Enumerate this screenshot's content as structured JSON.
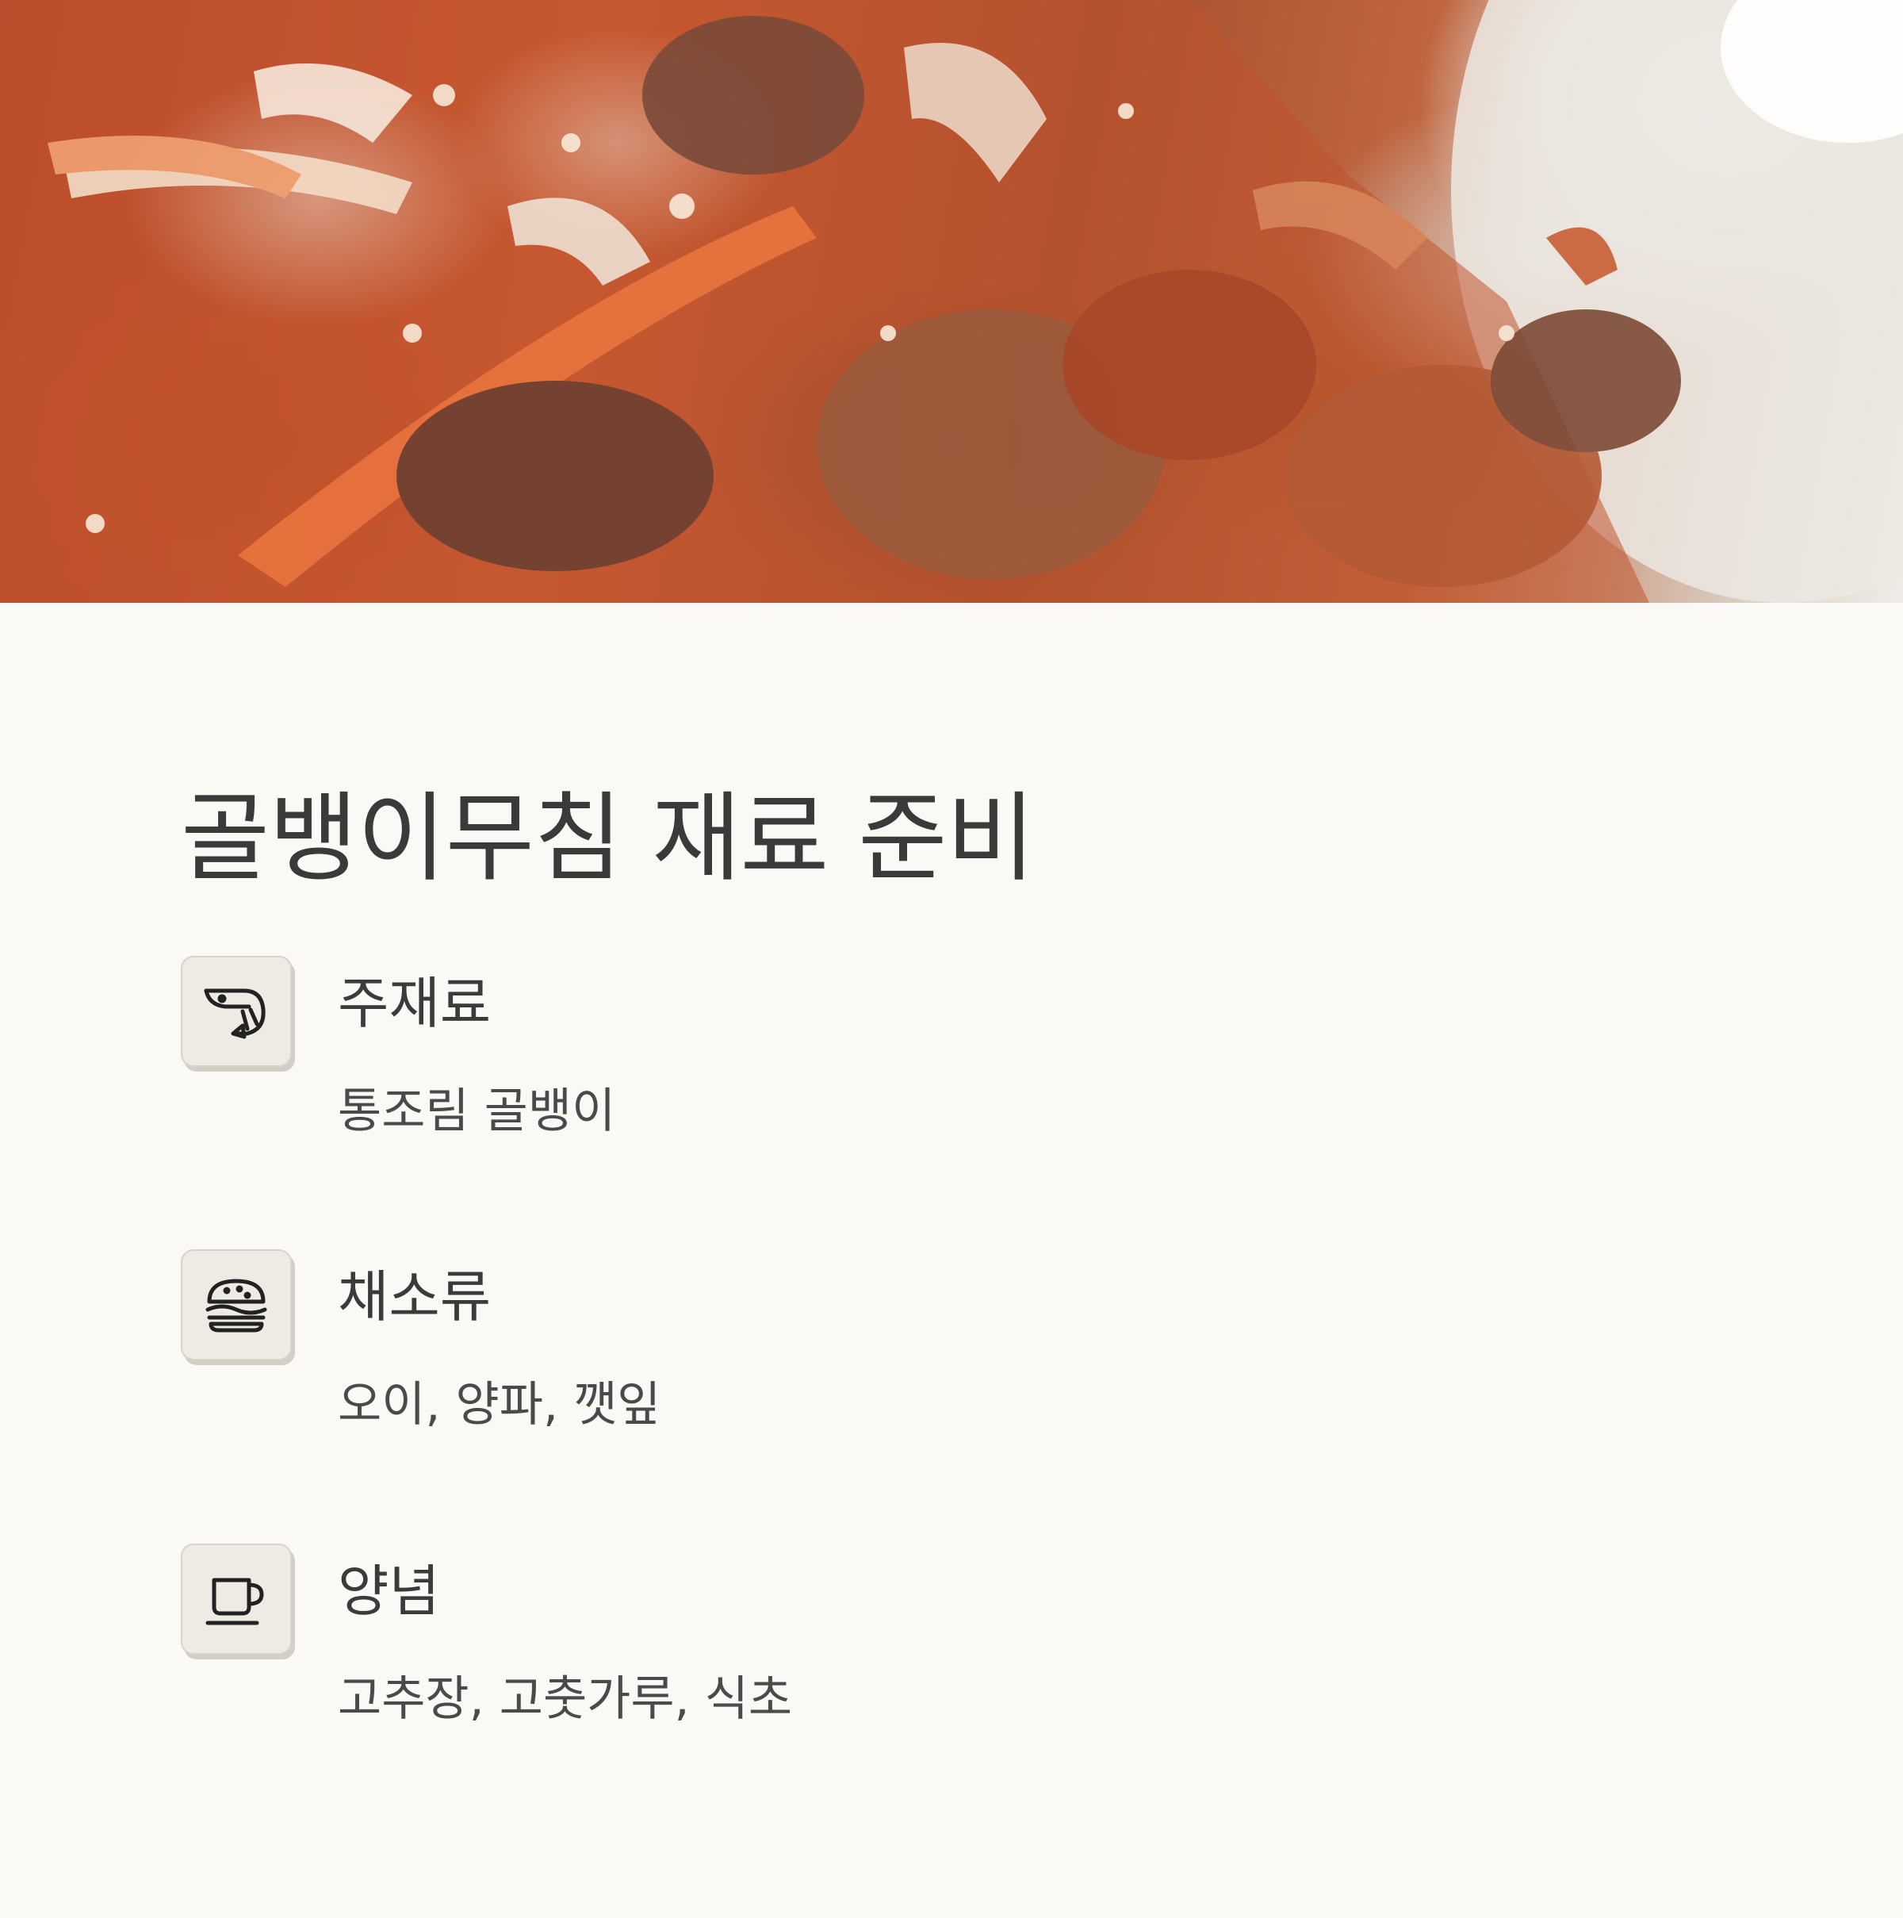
{
  "hero": {
    "image": "golbaengi-muchim-photo"
  },
  "title": "골뱅이무침 재료 준비",
  "items": [
    {
      "icon": "shrimp-icon",
      "title": "주재료",
      "desc": "통조림 골뱅이"
    },
    {
      "icon": "burger-icon",
      "title": "채소류",
      "desc": "오이, 양파, 깻잎"
    },
    {
      "icon": "cup-icon",
      "title": "양념",
      "desc": "고추장, 고춧가루, 식초"
    }
  ]
}
